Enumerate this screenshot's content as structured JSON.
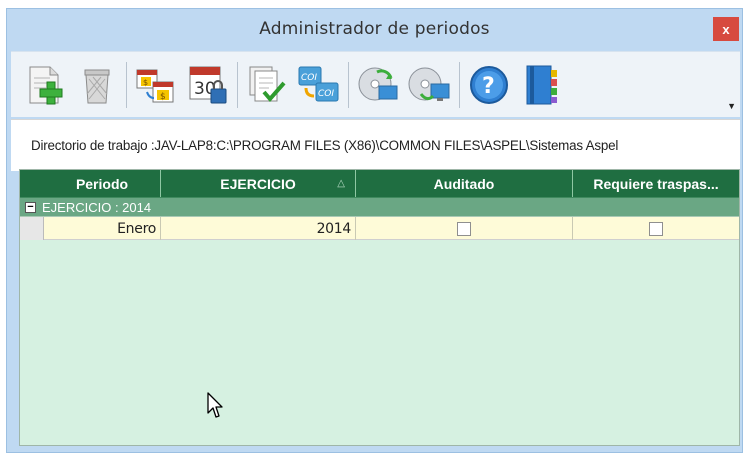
{
  "window": {
    "title": "Administrador de periodos",
    "close_label": "x"
  },
  "toolbar": {
    "buttons": [
      {
        "name": "add-period-button",
        "icon": "document-plus-icon"
      },
      {
        "name": "delete-button",
        "icon": "trash-icon"
      },
      {
        "name": "calendar-transfer-button",
        "icon": "calendar-money-icon"
      },
      {
        "name": "close-period-button",
        "icon": "calendar-lock-icon"
      },
      {
        "name": "audit-button",
        "icon": "document-check-icon"
      },
      {
        "name": "coi-copy-button",
        "icon": "coi-copy-icon"
      },
      {
        "name": "disc-refresh-button",
        "icon": "disc-refresh-icon"
      },
      {
        "name": "disc-transfer-button",
        "icon": "disc-monitor-icon"
      },
      {
        "name": "help-button",
        "icon": "help-icon"
      },
      {
        "name": "binder-button",
        "icon": "binder-icon"
      }
    ]
  },
  "directory": {
    "text": "Directorio de trabajo :JAV-LAP8:C:\\PROGRAM FILES (X86)\\COMMON FILES\\ASPEL\\Sistemas Aspel"
  },
  "grid": {
    "columns": [
      "Periodo",
      "EJERCICIO",
      "Auditado",
      "Requiere traspas..."
    ],
    "sort_indicator": "△",
    "group": {
      "toggle": "−",
      "label": "EJERCICIO : 2014"
    },
    "rows": [
      {
        "periodo": "Enero",
        "ejercicio": "2014",
        "auditado": false,
        "requiere_traspaso": false
      }
    ]
  },
  "colors": {
    "header": "#1f6e41",
    "group": "#6aa784",
    "row": "#fefbd8",
    "grid_bg": "#d6f1e1",
    "window_bg": "#bfd9f2",
    "close": "#d74a3f"
  }
}
